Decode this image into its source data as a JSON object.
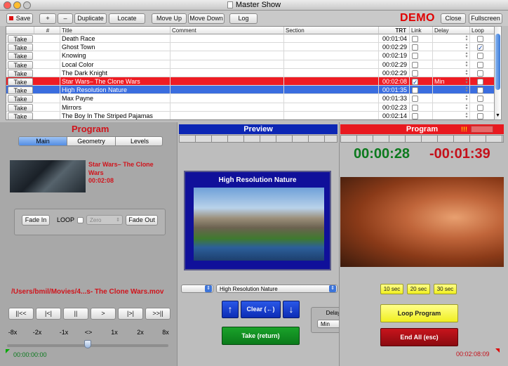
{
  "window": {
    "title": "Master Show"
  },
  "toolbar": {
    "save": "Save",
    "add": "+",
    "remove": "–",
    "duplicate": "Duplicate",
    "locate": "Locate",
    "move_up": "Move Up",
    "move_down": "Move Down",
    "log": "Log",
    "demo": "DEMO",
    "close": "Close",
    "fullscreen": "Fullscreen"
  },
  "table": {
    "headers": {
      "take": "",
      "num": "#",
      "title": "Title",
      "comment": "Comment",
      "section": "Section",
      "trt": "TRT",
      "link": "Link",
      "delay": "Delay",
      "loop": "Loop"
    },
    "take_label": "Take",
    "rows": [
      {
        "title": "Death Race",
        "trt": "00:01:04",
        "delay": "",
        "link": false,
        "loop": false
      },
      {
        "title": "Ghost Town",
        "trt": "00:02:29",
        "delay": "",
        "link": false,
        "loop": true
      },
      {
        "title": "Knowing",
        "trt": "00:02:19",
        "delay": "",
        "link": false,
        "loop": false
      },
      {
        "title": "Local Color",
        "trt": "00:02:29",
        "delay": "",
        "link": false,
        "loop": false
      },
      {
        "title": "The Dark Knight",
        "trt": "00:02:29",
        "delay": "",
        "link": false,
        "loop": false
      },
      {
        "title": "Star Wars– The Clone Wars",
        "trt": "00:02:08",
        "delay": "Min",
        "link": true,
        "loop": false
      },
      {
        "title": "High Resolution Nature",
        "trt": "00:01:35",
        "delay": "",
        "link": false,
        "loop": false
      },
      {
        "title": "Max Payne",
        "trt": "00:01:33",
        "delay": "",
        "link": false,
        "loop": false
      },
      {
        "title": "Mirrors",
        "trt": "00:02:23",
        "delay": "",
        "link": false,
        "loop": false
      },
      {
        "title": "The Boy In The Striped Pajamas",
        "trt": "00:02:14",
        "delay": "",
        "link": false,
        "loop": false
      }
    ]
  },
  "program_panel": {
    "heading": "Program",
    "tabs": [
      "Main",
      "Geometry",
      "Levels"
    ],
    "clip_title": "Star Wars– The Clone Wars",
    "clip_duration": "00:02:08",
    "fade_in": "Fade In",
    "loop_label": "LOOP",
    "zero_option": "Zero",
    "fade_out": "Fade Out",
    "file_path": "/Users/bmil/Movies/4...s- The Clone Wars.mov",
    "transport": [
      "||<<",
      "|<|",
      "||",
      ">",
      "|>|",
      ">>||"
    ],
    "speeds": [
      "-8x",
      "-2x",
      "-1x",
      "<>",
      "1x",
      "2x",
      "8x"
    ],
    "timecode_start": "00:00:00:00",
    "timecode_end": "00:02:08:09"
  },
  "preview": {
    "heading": "Preview",
    "clip_title": "High Resolution Nature",
    "selected_clip": "High Resolution Nature",
    "clear_label": "Clear (←)",
    "take_label": "Take (return)",
    "delay_label": "Delay (D)",
    "delay_value": "Min"
  },
  "program": {
    "heading": "Program",
    "indicator": "!!!",
    "elapsed": "00:00:28",
    "remaining": "-00:01:39",
    "quick_buttons": [
      "10 sec",
      "20 sec",
      "30 sec"
    ],
    "loop_program": "Loop Program",
    "end_all": "End All (esc)"
  },
  "colors": {
    "red": "#e8191f",
    "blue": "#0c26b4",
    "green_timer": "#0c7a1e",
    "red_timer": "#c4111b",
    "selected_row": "#3a6ddf"
  }
}
